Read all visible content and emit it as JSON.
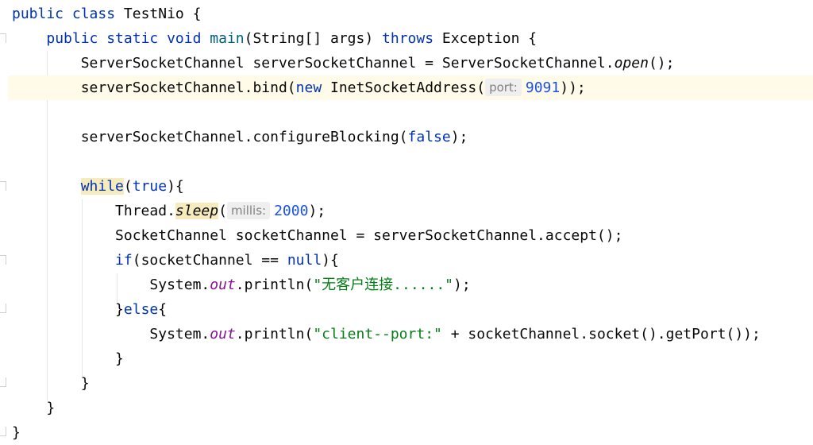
{
  "code": {
    "l1": {
      "kw": "public class ",
      "text": "TestNio {"
    },
    "l2": {
      "kw1": "public static void ",
      "meth": "main",
      "t1": "(String[] args) ",
      "kw2": "throws",
      "t2": " Exception {"
    },
    "l3": {
      "t1": "ServerSocketChannel serverSocketChannel = ServerSocketChannel.",
      "call": "open",
      "t2": "();"
    },
    "l4": {
      "t1": "serverSocketChannel.bind(",
      "kw": "new",
      "t2": " InetSocketAddress(",
      "hint": "port:",
      "num": "9091",
      "t3": "));"
    },
    "l6": {
      "t1": "serverSocketChannel.configureBlocking(",
      "kw": "false",
      "t2": ");"
    },
    "l8": {
      "kw1": "while",
      "t1": "(",
      "kw2": "true",
      "t2": "){"
    },
    "l9": {
      "t1": "Thread.",
      "call": "sleep",
      "t2": "(",
      "hint": "millis:",
      "num": "2000",
      "t3": ");"
    },
    "l10": {
      "text": "SocketChannel socketChannel = serverSocketChannel.accept();"
    },
    "l11": {
      "kw1": "if",
      "t1": "(socketChannel == ",
      "kw2": "null",
      "t2": "){"
    },
    "l12": {
      "t1": "System.",
      "field": "out",
      "t2": ".println(",
      "str": "\"无客户连接......\"",
      "t3": ");"
    },
    "l13": {
      "t1": "}",
      "kw": "else",
      "t2": "{"
    },
    "l14": {
      "t1": "System.",
      "field": "out",
      "t2": ".println(",
      "str": "\"client--port:\"",
      "t3": " + socketChannel.socket().getPort());"
    },
    "l15": {
      "text": "}"
    },
    "l16": {
      "text": "}"
    },
    "l17": {
      "text": "}"
    },
    "l18": {
      "text": "}"
    }
  },
  "colors": {
    "keyword": "#0033b3",
    "method_decl": "#00627a",
    "number": "#1750eb",
    "string": "#067d17",
    "static_field": "#871094",
    "current_line": "#fffbe8",
    "match_highlight": "#f6ebbc"
  }
}
